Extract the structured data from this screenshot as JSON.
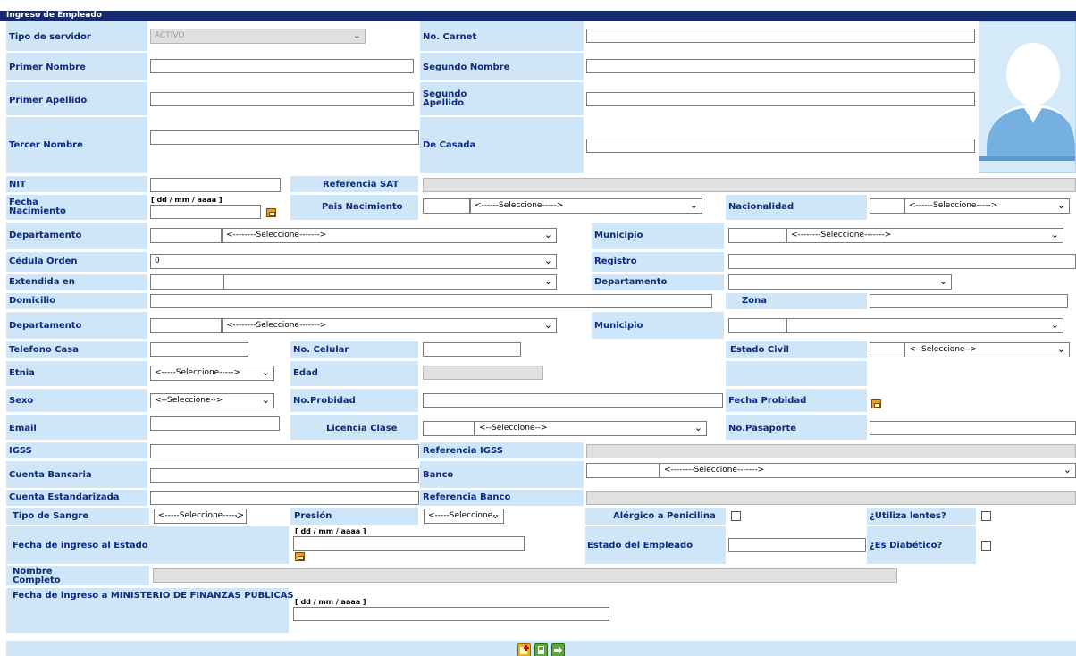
{
  "header": {
    "title": "Ingreso de Empleado"
  },
  "labels": {
    "tipo_servidor": "Tipo de servidor",
    "no_carnet": "No. Carnet",
    "primer_nombre": "Primer Nombre",
    "segundo_nombre": "Segundo Nombre",
    "primer_apellido": "Primer Apellido",
    "segundo_apellido": "Segundo Apellido",
    "tercer_nombre": "Tercer Nombre",
    "de_casada": "De Casada",
    "nit": "NIT",
    "referencia_sat": "Referencia SAT",
    "fecha_nacimiento": "Fecha Nacimiento",
    "pais_nacimiento": "Pais Nacimiento",
    "nacionalidad": "Nacionalidad",
    "departamento": "Departamento",
    "municipio": "Municipio",
    "cedula_orden": "Cédula Orden",
    "registro": "Registro",
    "extendida_en": "Extendida en",
    "domicilio": "Domicilio",
    "zona": "Zona",
    "telefono_casa": "Telefono Casa",
    "no_celular": "No. Celular",
    "estado_civil": "Estado Civil",
    "etnia": "Etnia",
    "edad": "Edad",
    "sexo": "Sexo",
    "no_probidad": "No.Probidad",
    "fecha_probidad": "Fecha Probidad",
    "email": "Email",
    "licencia_clase": "Licencia Clase",
    "no_pasaporte": "No.Pasaporte",
    "igss": "IGSS",
    "referencia_igss": "Referencia IGSS",
    "cuenta_bancaria": "Cuenta Bancaria",
    "banco": "Banco",
    "cuenta_estandarizada": "Cuenta Estandarizada",
    "referencia_banco": "Referencia Banco",
    "tipo_sangre": "Tipo de Sangre",
    "presion": "Presión",
    "alergico": "Alérgico a Penicilina",
    "utiliza_lentes": "¿Utiliza lentes?",
    "fecha_ingreso_estado": "Fecha de ingreso al Estado",
    "estado_empleado": "Estado del Empleado",
    "es_diabetico": "¿Es Diabético?",
    "nombre_completo": "Nombre Completo",
    "fecha_ingreso_ministerio": "Fecha de ingreso a MINISTERIO DE FINANZAS PUBLICAS"
  },
  "date_hint": "[ dd / mm / aaaa ]",
  "values": {
    "tipo_servidor": "ACTIVO",
    "cedula_orden": "0",
    "pais_nacimiento": "<------Seleccione----->",
    "nacionalidad": "<------Seleccione----->",
    "departamento": "<--------Seleccione------->",
    "municipio": "<--------Seleccione------->",
    "departamento2": "<--------Seleccione------->",
    "estado_civil": "<--Seleccione-->",
    "etnia": "<-----Seleccione----->",
    "sexo": "<--Seleccione-->",
    "licencia_clase": "<--Seleccione-->",
    "banco": "<--------Seleccione------->",
    "tipo_sangre": "<-----Seleccione-----> ",
    "presion": "<-----Seleccione--"
  },
  "icons": {
    "chevron": "chevron-down-icon",
    "calendar": "calendar-icon",
    "avatar": "avatar-silhouette-icon"
  },
  "colors": {
    "header_bg": "#152a6f",
    "label_bg": "#cfe5f8",
    "label_text": "#0d2b7e"
  }
}
